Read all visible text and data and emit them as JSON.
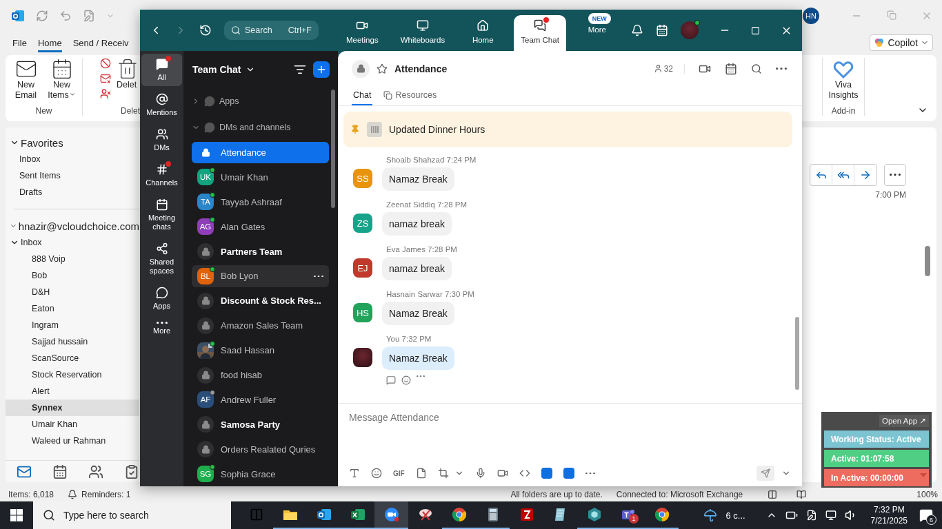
{
  "outlook": {
    "account_initials": "HN",
    "menu": [
      {
        "label": "File",
        "selected": false
      },
      {
        "label": "Home",
        "selected": true
      },
      {
        "label": "Send / Receiv",
        "selected": false
      }
    ],
    "copilot": "Copilot",
    "ribbon": {
      "new_group": {
        "label": "New",
        "buttons": [
          {
            "label": "New Email",
            "menu": false
          },
          {
            "label": "New Items",
            "menu": true
          }
        ]
      },
      "delete_group": {
        "label": "Delet",
        "button": "Delet"
      },
      "addin_group": {
        "label": "Add-in",
        "button": "Viva Insights"
      }
    },
    "favorites": {
      "label": "Favorites",
      "expanded": true,
      "items": [
        {
          "label": "Inbox",
          "selected": false
        },
        {
          "label": "Sent Items",
          "selected": false
        },
        {
          "label": "Drafts",
          "selected": false
        }
      ]
    },
    "account": {
      "label": "hnazir@vcloudchoice.com",
      "expanded": true,
      "children": [
        {
          "label": "Inbox",
          "selected": false,
          "expanded": true,
          "children": [
            {
              "label": "888 Voip",
              "selected": false
            },
            {
              "label": "Bob",
              "selected": false
            },
            {
              "label": "D&H",
              "selected": false
            },
            {
              "label": "Eaton",
              "selected": false
            },
            {
              "label": "Ingram",
              "selected": false
            },
            {
              "label": "Sajjad hussain",
              "selected": false
            },
            {
              "label": "ScanSource",
              "selected": false
            },
            {
              "label": "Stock Reservation",
              "selected": false
            },
            {
              "label": "Alert",
              "selected": false
            },
            {
              "label": "Synnex",
              "selected": true
            },
            {
              "label": "Umair Khan",
              "selected": false
            },
            {
              "label": "Waleed ur Rahman",
              "selected": false
            }
          ]
        }
      ]
    },
    "nav": [
      {
        "kind": "mail",
        "selected": true
      },
      {
        "kind": "calendar",
        "selected": false
      },
      {
        "kind": "people",
        "selected": false
      },
      {
        "kind": "tasks",
        "selected": false
      }
    ],
    "reading": {
      "time": "7:00 PM"
    },
    "status": {
      "items": "Items: 6,018",
      "reminders": "Reminders: 1",
      "sync": "All folders are up to date.",
      "connection": "Connected to: Microsoft Exchange",
      "zoom": "100%"
    }
  },
  "zoom": {
    "search": {
      "placeholder": "Search",
      "shortcut": "Ctrl+F"
    },
    "nav": [
      {
        "label": "Meetings",
        "kind": "video",
        "selected": false,
        "dot": false
      },
      {
        "label": "Whiteboards",
        "kind": "board",
        "selected": false,
        "dot": false
      },
      {
        "label": "Home",
        "kind": "home",
        "selected": false,
        "dot": false
      },
      {
        "label": "Team Chat",
        "kind": "chat",
        "selected": true,
        "dot": true
      },
      {
        "label": "More",
        "kind": "more",
        "selected": false,
        "dot": false,
        "badge": "NEW"
      }
    ],
    "rail": [
      {
        "label": "All",
        "kind": "all",
        "selected": true,
        "dot": true
      },
      {
        "label": "Mentions",
        "kind": "mentions",
        "selected": false,
        "dot": false
      },
      {
        "label": "DMs",
        "kind": "dms",
        "selected": false,
        "dot": false
      },
      {
        "label": "Channels",
        "kind": "channels",
        "selected": false,
        "dot": true
      },
      {
        "label": "Meeting chats",
        "kind": "meetings",
        "selected": false,
        "dot": false
      },
      {
        "label": "Shared spaces",
        "kind": "spaces",
        "selected": false,
        "dot": false
      },
      {
        "label": "Apps",
        "kind": "apps",
        "selected": false,
        "dot": false
      },
      {
        "label": "More",
        "kind": "more",
        "selected": false,
        "dot": false
      }
    ],
    "list": {
      "title": "Team Chat",
      "sections": [
        {
          "label": "Apps",
          "expanded": false
        },
        {
          "label": "DMs and channels",
          "expanded": true
        }
      ],
      "items": [
        {
          "name": "Attendance",
          "kind": "channel",
          "selected": true,
          "unread": false,
          "hovered": false
        },
        {
          "name": "Umair Khan",
          "kind": "person",
          "initials": "UK",
          "color": "#14a37f",
          "online": true,
          "selected": false,
          "unread": false,
          "hovered": false
        },
        {
          "name": "Tayyab Ashraaf",
          "kind": "person",
          "initials": "TA",
          "color": "#2a86c8",
          "online": true,
          "selected": false,
          "unread": false,
          "hovered": false
        },
        {
          "name": "Alan Gates",
          "kind": "person",
          "initials": "AG",
          "color": "#8e3fb8",
          "online": true,
          "selected": false,
          "unread": false,
          "hovered": false
        },
        {
          "name": "Partners Team",
          "kind": "channel",
          "selected": false,
          "unread": true,
          "hovered": false
        },
        {
          "name": "Bob Lyon",
          "kind": "person",
          "initials": "BL",
          "color": "#e0620b",
          "online": true,
          "selected": false,
          "unread": false,
          "hovered": true
        },
        {
          "name": "Discount & Stock Res...",
          "kind": "channel",
          "selected": false,
          "unread": true,
          "hovered": false
        },
        {
          "name": "Amazon Sales Team",
          "kind": "channel",
          "selected": false,
          "unread": false,
          "hovered": false
        },
        {
          "name": "Saad Hassan",
          "online": true,
          "selected": false,
          "unread": false,
          "hovered": false
        },
        {
          "name": "food hisab",
          "kind": "channel",
          "selected": false,
          "unread": false,
          "hovered": false
        },
        {
          "name": "Andrew Fuller",
          "kind": "person",
          "initials": "AF",
          "color": "#2b4f7a",
          "online": false,
          "selected": false,
          "unread": false,
          "hovered": false
        },
        {
          "name": "Samosa Party",
          "kind": "channel",
          "selected": false,
          "unread": true,
          "hovered": false
        },
        {
          "name": "Orders Realated Quries",
          "kind": "channel",
          "selected": false,
          "unread": false,
          "hovered": false
        },
        {
          "name": "Sophia Grace",
          "kind": "person",
          "initials": "SG",
          "color": "#1fae4e",
          "online": true,
          "selected": false,
          "unread": false,
          "hovered": false
        }
      ]
    },
    "channel": {
      "title": "Attendance",
      "members": "32",
      "tabs": [
        {
          "label": "Chat",
          "selected": true
        },
        {
          "label": "Resources",
          "selected": false
        }
      ],
      "pinned": "Updated Dinner Hours"
    },
    "messages": [
      {
        "kind": "other",
        "sender": "Shoaib Shahzad",
        "time": "7:24 PM",
        "initials": "SS",
        "color": "#e8940f",
        "text": "Namaz Break"
      },
      {
        "kind": "other",
        "sender": "Zeenat Siddiq",
        "time": "7:28 PM",
        "initials": "ZS",
        "color": "#17a38a",
        "text": "namaz break"
      },
      {
        "kind": "other",
        "sender": "Eva James",
        "time": "7:28 PM",
        "initials": "EJ",
        "color": "#c0392b",
        "text": "namaz break"
      },
      {
        "kind": "other",
        "sender": "Hasnain Sarwar",
        "time": "7:30 PM",
        "initials": "HS",
        "color": "#21a35a",
        "text": "Namaz Break"
      },
      {
        "kind": "own",
        "sender": "You",
        "time": "7:32 PM",
        "text": "Namaz Break"
      }
    ],
    "composer": {
      "placeholder": "Message Attendance",
      "gif": "GIF"
    }
  },
  "widget": {
    "open_app": "Open App ↗",
    "rows": [
      {
        "text": "Working Status: Active",
        "color": "#7cc4d2"
      },
      {
        "text": "Active: 01:07:58",
        "color": "#4fce84"
      },
      {
        "text": "In Active: 00:00:00",
        "color": "#ed6b5f",
        "menu": true
      }
    ]
  },
  "taskbar": {
    "search_placeholder": "Type here to search",
    "apps": [
      {
        "kind": "explorer",
        "active": false,
        "running": true
      },
      {
        "kind": "outlook",
        "active": false,
        "running": true
      },
      {
        "kind": "excel",
        "active": false,
        "running": true
      },
      {
        "kind": "zoom",
        "active": true,
        "running": true
      },
      {
        "kind": "snip",
        "active": false,
        "running": false
      },
      {
        "kind": "chrome",
        "active": false,
        "running": true
      },
      {
        "kind": "calculator",
        "active": false,
        "running": true
      },
      {
        "kind": "filezilla",
        "active": false,
        "running": false
      },
      {
        "kind": "notepad",
        "active": false,
        "running": false
      },
      {
        "kind": "hex",
        "active": false,
        "running": true
      },
      {
        "kind": "teams",
        "active": false,
        "running": true,
        "badge": "1"
      },
      {
        "kind": "chrome",
        "active": false,
        "running": true
      }
    ],
    "weather": "6 c...",
    "time": "7:32 PM",
    "date": "7/21/2025",
    "notifications": "6"
  }
}
